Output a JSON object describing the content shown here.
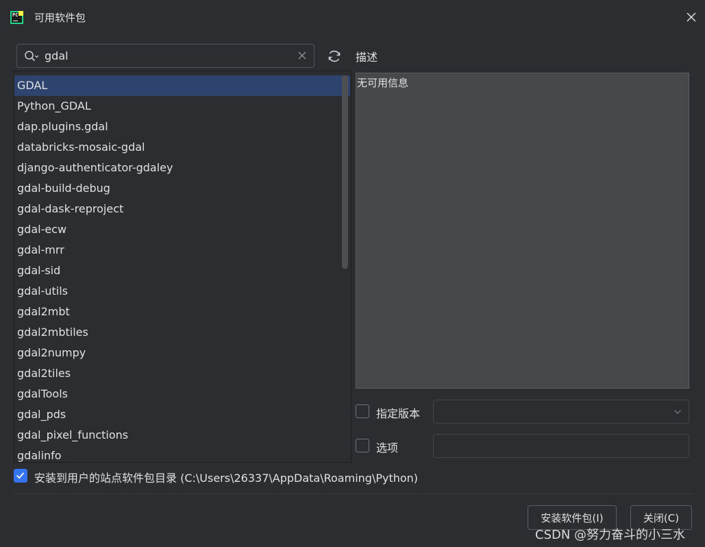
{
  "window": {
    "title": "可用软件包",
    "app_icon_text": "PC"
  },
  "search": {
    "value": "gdal"
  },
  "packages": [
    "GDAL",
    "Python_GDAL",
    "dap.plugins.gdal",
    "databricks-mosaic-gdal",
    "django-authenticator-gdaley",
    "gdal-build-debug",
    "gdal-dask-reproject",
    "gdal-ecw",
    "gdal-mrr",
    "gdal-sid",
    "gdal-utils",
    "gdal2mbt",
    "gdal2mbtiles",
    "gdal2numpy",
    "gdal2tiles",
    "gdalTools",
    "gdal_pds",
    "gdal_pixel_functions",
    "gdalinfo"
  ],
  "selected_index": 0,
  "description": {
    "label": "描述",
    "text": "无可用信息"
  },
  "options": {
    "specify_version_label": "指定版本",
    "specify_version_checked": false,
    "options_label": "选项",
    "options_checked": false,
    "install_user_site_label": "安装到用户的站点软件包目录 (C:\\Users\\26337\\AppData\\Roaming\\Python)",
    "install_user_site_checked": true
  },
  "buttons": {
    "install": "安装软件包(I)",
    "close": "关闭(C)"
  },
  "watermark": "CSDN @努力奋斗的小三水",
  "colors": {
    "background": "#2b2d30",
    "selection": "#2e436e",
    "accent": "#3574f0",
    "description_bg": "#45494a"
  },
  "icons": {
    "app": "pycharm-logo-icon",
    "close": "close-icon",
    "search": "search-icon",
    "clear": "clear-icon",
    "refresh": "refresh-icon",
    "dropdown": "chevron-down-icon",
    "check": "check-icon"
  }
}
